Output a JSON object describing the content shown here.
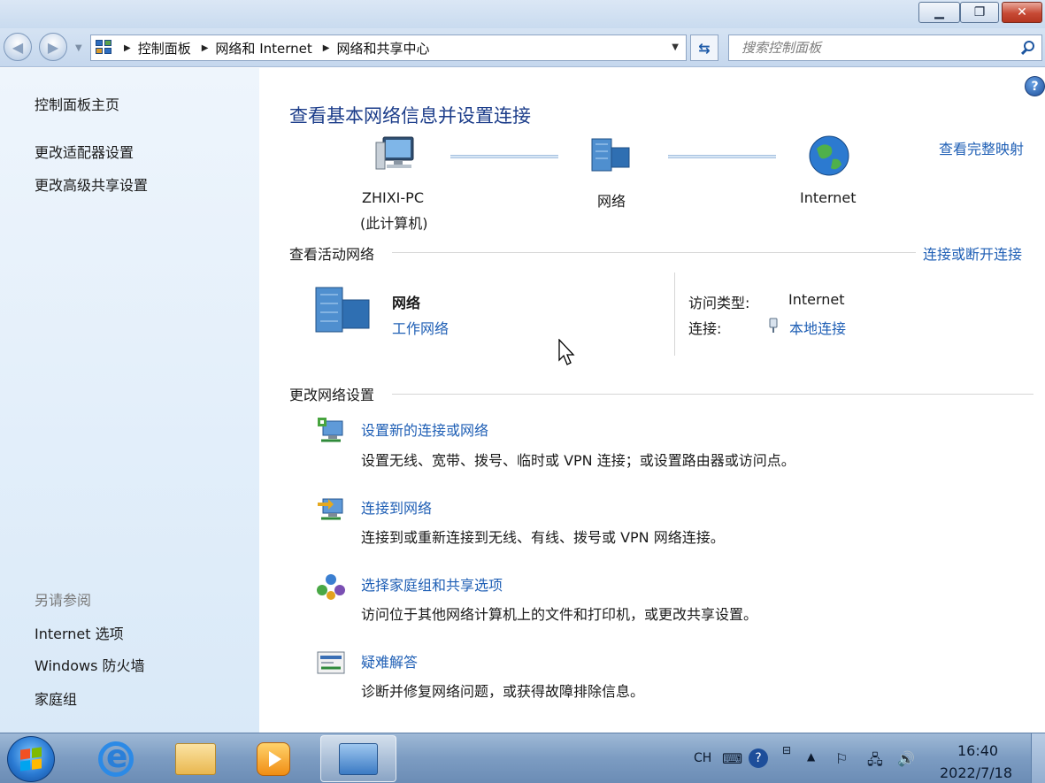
{
  "window": {
    "minimize_glyph": "▁",
    "maximize_glyph": "❐",
    "close_glyph": "✕"
  },
  "addressbar": {
    "crumbs": [
      "控制面板",
      "网络和 Internet",
      "网络和共享中心"
    ],
    "search_placeholder": "搜索控制面板"
  },
  "sidebar": {
    "links": [
      "控制面板主页",
      "更改适配器设置",
      "更改高级共享设置"
    ],
    "see_also_heading": "另请参阅",
    "see_also": [
      "Internet 选项",
      "Windows 防火墙",
      "家庭组"
    ]
  },
  "main": {
    "title": "查看基本网络信息并设置连接",
    "network_map": {
      "computer_name": "ZHIXI-PC",
      "computer_sub": "(此计算机)",
      "network": "网络",
      "internet": "Internet",
      "full_map_link": "查看完整映射"
    },
    "active": {
      "heading": "查看活动网络",
      "connect_link": "连接或断开连接",
      "network_name": "网络",
      "network_type": "工作网络",
      "access_type_label": "访问类型:",
      "access_type_value": "Internet",
      "connections_label": "连接:",
      "connections_value": "本地连接"
    },
    "change": {
      "heading": "更改网络设置",
      "tasks": [
        {
          "title": "设置新的连接或网络",
          "desc": "设置无线、宽带、拨号、临时或 VPN 连接；或设置路由器或访问点。"
        },
        {
          "title": "连接到网络",
          "desc": "连接到或重新连接到无线、有线、拨号或 VPN 网络连接。"
        },
        {
          "title": "选择家庭组和共享选项",
          "desc": "访问位于其他网络计算机上的文件和打印机，或更改共享设置。"
        },
        {
          "title": "疑难解答",
          "desc": "诊断并修复网络问题，或获得故障排除信息。"
        }
      ]
    }
  },
  "taskbar": {
    "lang": "CH",
    "time": "16:40",
    "date": "2022/7/18"
  },
  "colors": {
    "link": "#1f5fb5",
    "title": "#1c3d8a",
    "sidebar_top": "#eef5fc",
    "sidebar_bottom": "#d9e9f8"
  }
}
